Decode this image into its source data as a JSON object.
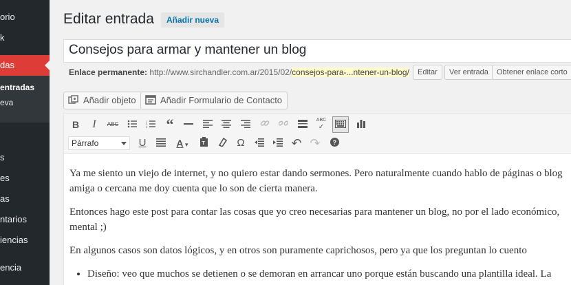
{
  "sidebar": {
    "items": [
      {
        "label": "orio"
      },
      {
        "label": "k"
      },
      {
        "label": "das"
      },
      {
        "label": "s"
      },
      {
        "label": "es"
      },
      {
        "label": "as"
      },
      {
        "label": "ntarios"
      },
      {
        "label": "iencias"
      },
      {
        "label": "encia"
      }
    ],
    "submenu": [
      {
        "label": "entradas"
      },
      {
        "label": "eva"
      }
    ]
  },
  "header": {
    "title": "Editar entrada",
    "add_new": "Añadir nueva"
  },
  "post": {
    "title": "Consejos para armar y mantener un blog"
  },
  "permalink": {
    "label": "Enlace permanente:",
    "base": "http://www.sirchandler.com.ar/2015/02/",
    "slug": "consejos-para-...ntener-un-blog/",
    "edit": "Editar",
    "view": "Ver entrada",
    "shortlink": "Obtener enlace corto"
  },
  "media": {
    "add_object": "Añadir objeto",
    "add_form": "Añadir Formulario de Contacto"
  },
  "toolbar": {
    "format": "Párrafo"
  },
  "content": {
    "p1_line1": "Ya me siento un viejo de internet, y no quiero estar dando sermones. Pero naturalmente cuando hablo de páginas o blog",
    "p1_line2": "amiga o cercana me doy cuenta que lo son de cierta manera.",
    "p2_line1": "Entonces hago este post para contar las cosas que yo creo necesarias para mantener un blog, no por el lado económico,",
    "p2_line2": "mental ;)",
    "p3": "En algunos casos son datos lógicos, y en otros son puramente caprichosos, pero ya que los preguntan lo cuento",
    "li1": "Diseño: veo que muchos se detienen o se demoran en arrancar uno porque están buscando una plantilla ideal. La"
  }
}
